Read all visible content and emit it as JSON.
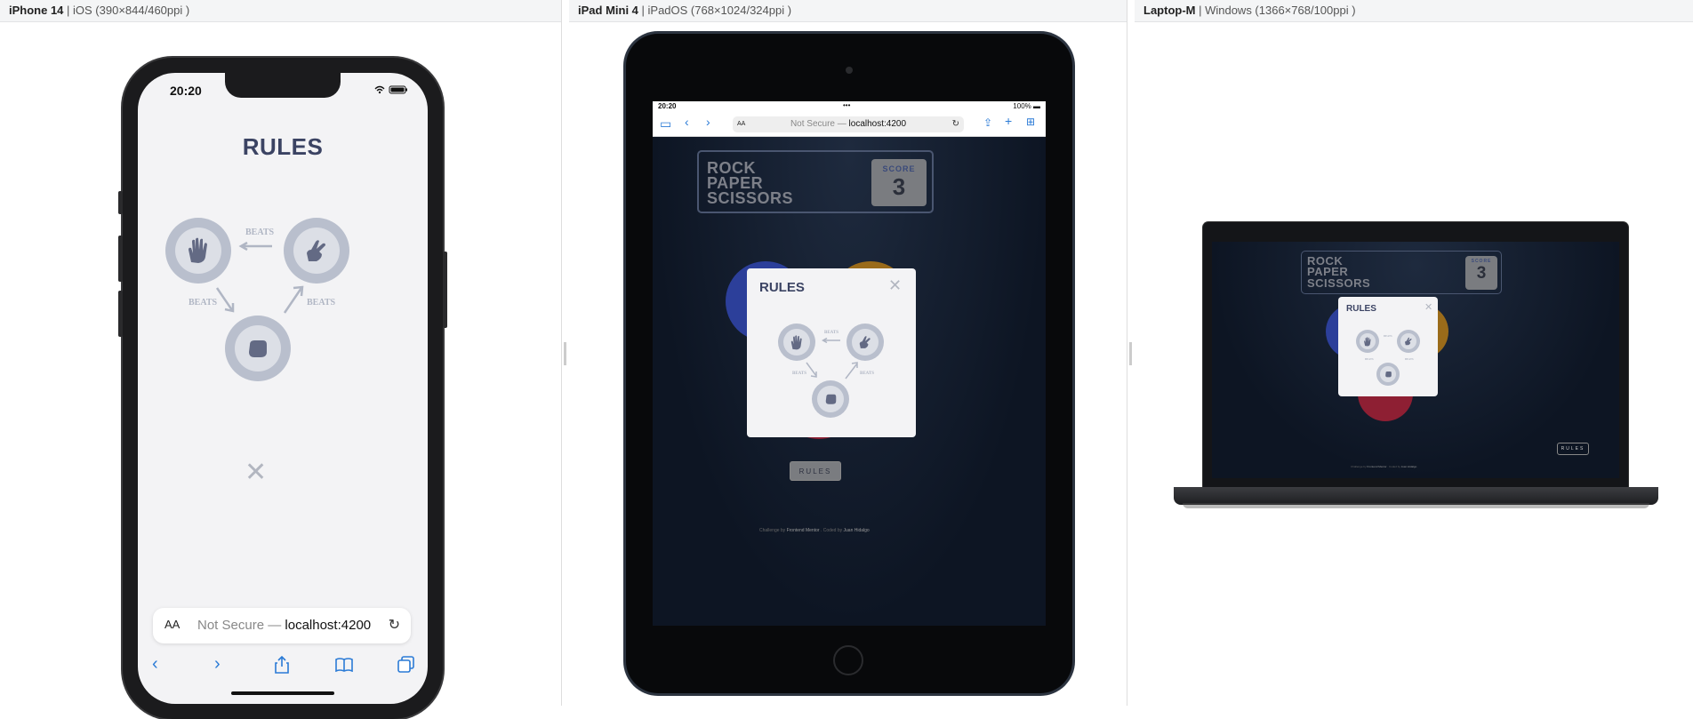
{
  "devices": {
    "iphone": {
      "name": "iPhone 14",
      "spec": " | iOS (390×844/460ppi )"
    },
    "ipad": {
      "name": "iPad Mini 4",
      "spec": " | iPadOS (768×1024/324ppi )"
    },
    "laptop": {
      "name": "Laptop-M",
      "spec": " | Windows (1366×768/100ppi )"
    }
  },
  "status": {
    "time": "20:20",
    "battery": "100%"
  },
  "browser": {
    "text_size_label": "AA",
    "security_label": "Not Secure —",
    "host": "localhost:4200"
  },
  "game": {
    "title_lines": [
      "ROCK",
      "PAPER",
      "SCISSORS"
    ],
    "score_label": "SCORE",
    "score_value": "3",
    "rules_button": "RULES",
    "attribution": {
      "challenge_by": "Challenge by",
      "challenge_name": "Frontend Mentor",
      "coded_by": ". Coded by",
      "coder": "Juan Hidalgo"
    }
  },
  "rules_modal": {
    "title": "RULES",
    "beats_label": "BEATS",
    "close_label": "✕"
  },
  "colors": {
    "paper": "#4865f4",
    "scissors": "#ec9e0e",
    "rock": "#dc2e4e",
    "token_ring": "#b9bfcd",
    "title": "#3b4363"
  },
  "icons": [
    "hand-paper-icon",
    "hand-scissors-icon",
    "hand-rock-icon",
    "arrow-left-icon",
    "arrow-down-right-icon",
    "arrow-up-right-icon",
    "close-icon",
    "wifi-icon",
    "battery-icon",
    "reload-icon",
    "back-icon",
    "forward-icon",
    "share-icon",
    "bookmarks-icon",
    "tabs-icon"
  ]
}
